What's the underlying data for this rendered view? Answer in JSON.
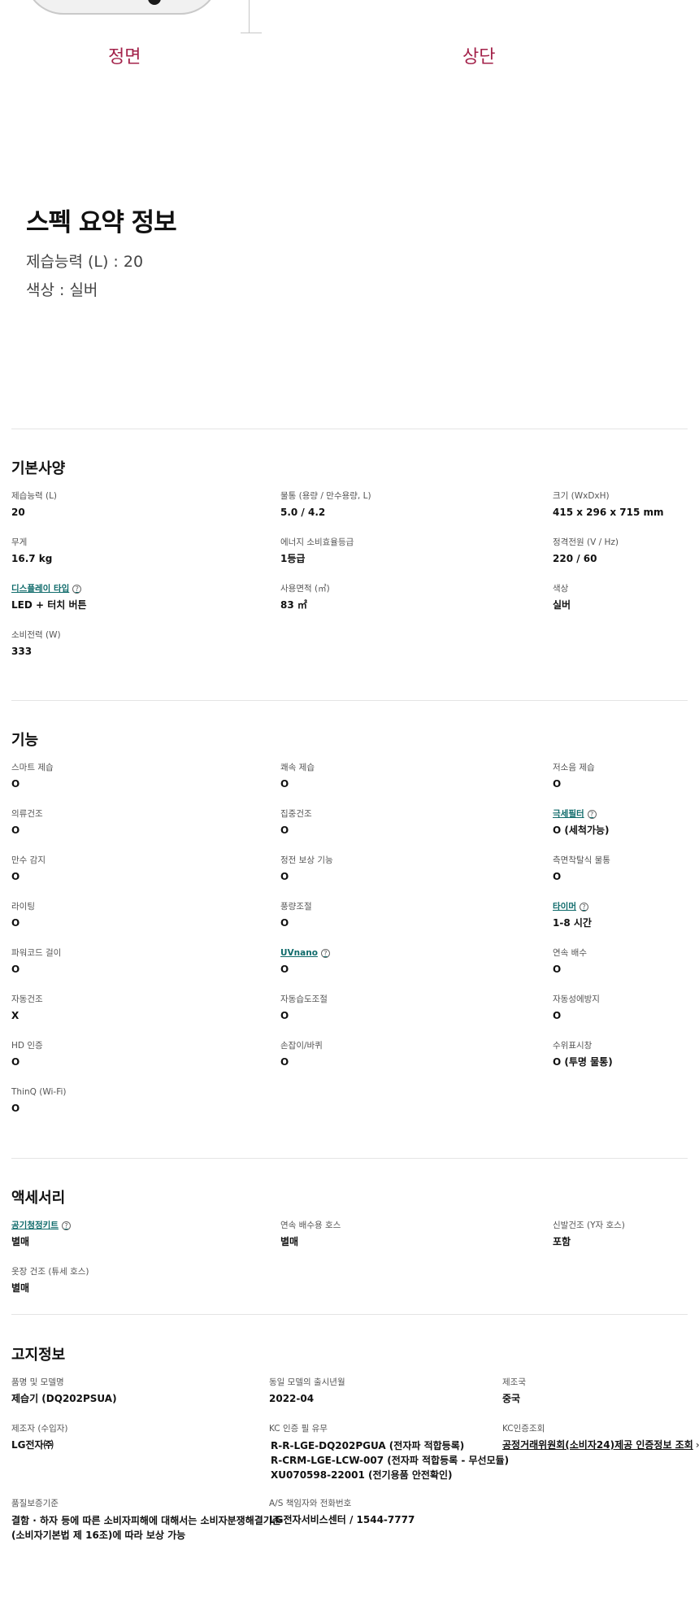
{
  "views": {
    "front": "정면",
    "top": "상단"
  },
  "summary": {
    "title": "스펙 요약 정보",
    "capacity": "제습능력 (L) : 20",
    "color": "색상 : 실버"
  },
  "basic": {
    "title": "기본사양",
    "items": [
      {
        "label": "제습능력 (L)",
        "value": "20"
      },
      {
        "label": "물통 (용량 / 만수용량, L)",
        "value": "5.0 / 4.2"
      },
      {
        "label": "크기 (WxDxH)",
        "value": "415 x 296 x 715 mm"
      },
      {
        "label": "무게",
        "value": "16.7 kg"
      },
      {
        "label": "에너지 소비효율등급",
        "value": "1등급"
      },
      {
        "label": "정격전원 (V / Hz)",
        "value": "220 / 60"
      },
      {
        "label": "디스플레이 타입",
        "value": "LED + 터치 버튼",
        "link": true
      },
      {
        "label": "사용면적 (㎡)",
        "value": "83 ㎡"
      },
      {
        "label": "색상",
        "value": "실버"
      },
      {
        "label": "소비전력 (W)",
        "value": "333"
      }
    ]
  },
  "features": {
    "title": "기능",
    "items": [
      {
        "label": "스마트 제습",
        "value": "O"
      },
      {
        "label": "쾌속 제습",
        "value": "O"
      },
      {
        "label": "저소음 제습",
        "value": "O"
      },
      {
        "label": "의류건조",
        "value": "O"
      },
      {
        "label": "집중건조",
        "value": "O"
      },
      {
        "label": "극세필터",
        "value": "O (세척가능)",
        "link": true
      },
      {
        "label": "만수 감지",
        "value": "O"
      },
      {
        "label": "정전 보상 기능",
        "value": "O"
      },
      {
        "label": "측면착탈식 물통",
        "value": "O"
      },
      {
        "label": "라이팅",
        "value": "O"
      },
      {
        "label": "풍량조절",
        "value": "O"
      },
      {
        "label": "타이머",
        "value": "1-8 시간",
        "link": true
      },
      {
        "label": "파워코드 걸이",
        "value": "O"
      },
      {
        "label": "UVnano",
        "value": "O",
        "link": true
      },
      {
        "label": "연속 배수",
        "value": "O"
      },
      {
        "label": "자동건조",
        "value": "X"
      },
      {
        "label": "자동습도조절",
        "value": "O"
      },
      {
        "label": "자동성에방지",
        "value": "O"
      },
      {
        "label": "HD 인증",
        "value": "O"
      },
      {
        "label": "손잡이/바퀴",
        "value": "O"
      },
      {
        "label": "수위표시창",
        "value": "O (투명 물통)"
      },
      {
        "label": "ThinQ (Wi-Fi)",
        "value": "O"
      }
    ]
  },
  "accessories": {
    "title": "액세서리",
    "items": [
      {
        "label": "공기청정키트",
        "value": "별매",
        "link": true
      },
      {
        "label": "연속 배수용 호스",
        "value": "별매"
      },
      {
        "label": "신발건조 (Y자 호스)",
        "value": "포함"
      },
      {
        "label": "옷장 건조 (튜세 호스)",
        "value": "별매"
      }
    ]
  },
  "notice": {
    "title": "고지정보",
    "product_label": "품명 및 모델명",
    "product_value": "제습기 (DQ202PSUA)",
    "release_label": "동일 모델의 출시년월",
    "release_value": "2022-04",
    "origin_label": "제조국",
    "origin_value": "중국",
    "maker_label": "제조자 (수입자)",
    "maker_value": "LG전자㈜",
    "kc_label": "KC 인증 필 유무",
    "kc_lines": [
      "R-R-LGE-DQ202PGUA (전자파 적합등록)",
      "R-CRM-LGE-LCW-007 (전자파 적합등록 - 무선모듈)",
      "XU070598-22001 (전기용품 안전확인)"
    ],
    "kc_lookup_label": "KC인증조회",
    "kc_lookup_value": "공정거래위원회(소비자24)제공 인증정보 조회",
    "quality_label": "품질보증기준",
    "quality_line1": "결함 · 하자 등에 따른 소비자피해에 대해서는 소비자분쟁해결기준",
    "quality_line2": "(소비자기본법 제 16조)에 따라 보상 가능",
    "as_label": "A/S 책임자와 전화번호",
    "as_value": "LG전자서비스센터 / 1544-7777"
  }
}
